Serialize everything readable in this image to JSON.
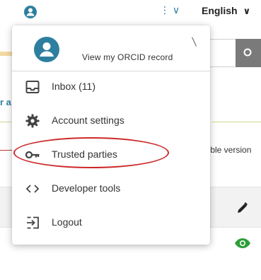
{
  "topbar": {
    "user_menu_indicator": "⋮ ∨",
    "language": {
      "selected": "English",
      "chevron": "∨"
    }
  },
  "background": {
    "left_fragment": "r a",
    "right_fragment": "ıble version"
  },
  "menu": {
    "header": {
      "link_label": "View my ORCID record"
    },
    "items": [
      {
        "label": "Inbox (11)",
        "icon": "inbox-icon"
      },
      {
        "label": "Account settings",
        "icon": "gear-icon"
      },
      {
        "label": "Trusted parties",
        "icon": "key-icon"
      },
      {
        "label": "Developer tools",
        "icon": "code-icon"
      },
      {
        "label": "Logout",
        "icon": "logout-icon"
      }
    ]
  },
  "colors": {
    "accent": "#2e7f9f",
    "eye_green": "#2e9e3a",
    "annotation_red": "#cc2a2a"
  }
}
